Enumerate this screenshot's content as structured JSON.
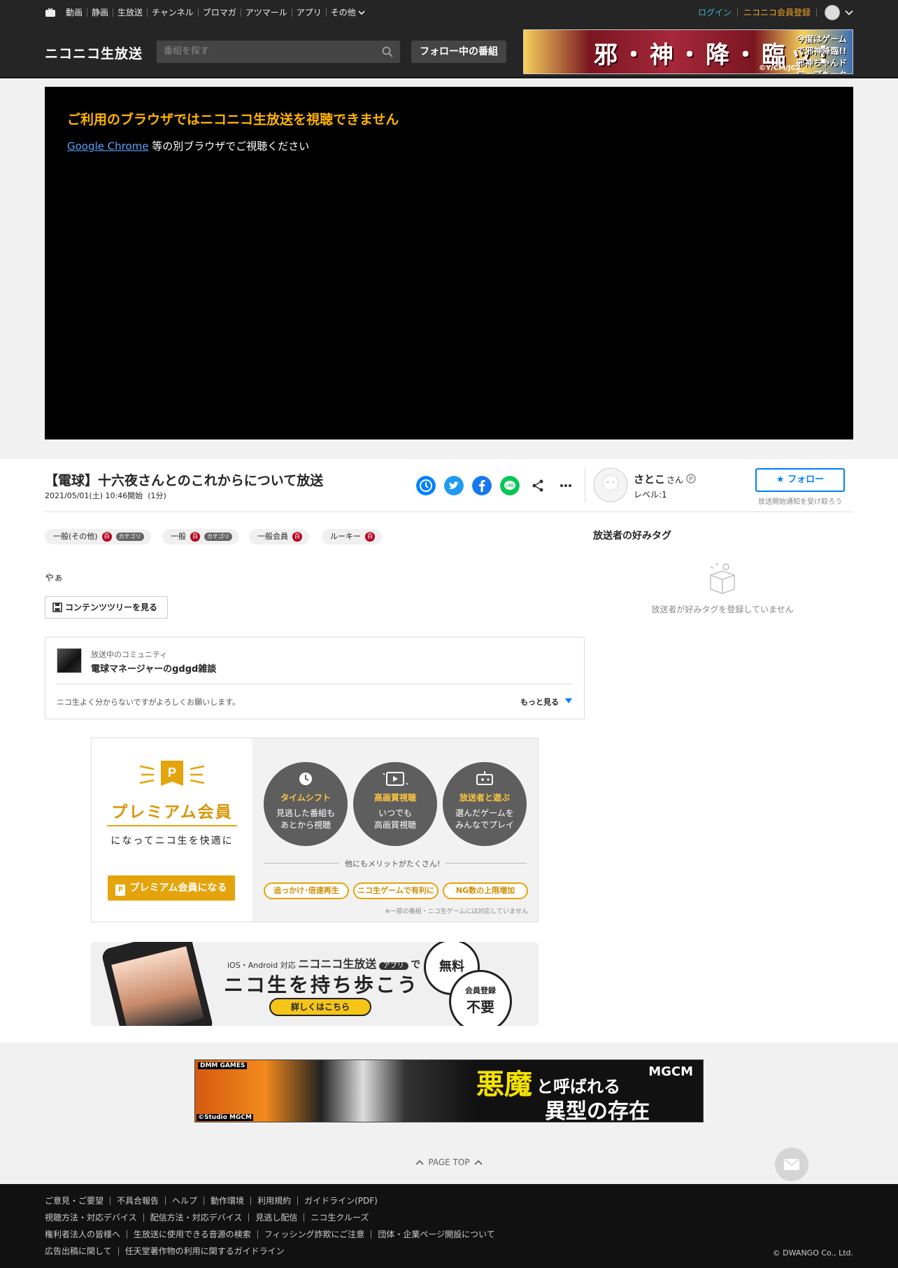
{
  "global_nav": {
    "items": [
      "動画",
      "静画",
      "生放送",
      "チャンネル",
      "ブロマガ",
      "アツマール",
      "アプリ",
      "その他"
    ],
    "login": "ログイン",
    "register": "ニコニコ会員登録"
  },
  "header": {
    "logo": "ニコニコ生放送",
    "search_placeholder": "番組を探す",
    "follow_programs": "フォロー中の番組",
    "banner_title": "邪・神・降・臨ッ!",
    "banner_right": "今度はゲームで邪神降臨!! 邪神ちゃんドロップキック ねじれグッズ",
    "banner_copy": "©Y/CM/JC2"
  },
  "player": {
    "error_title": "ご利用のブラウザではニコニコ生放送を視聴できません",
    "browser_link": "Google Chrome",
    "error_sub": " 等の別ブラウザでご視聴ください"
  },
  "program": {
    "title": "【電球】十六夜さんとのこれからについて放送",
    "start": "2021/05/01(土) 10:46開始",
    "duration": "(1分)",
    "description": "やぁ",
    "contents_tree": "コンテンツツリーを見る"
  },
  "tags": [
    {
      "label": "一般(その他)",
      "lock": "百",
      "category": "カテゴリ"
    },
    {
      "label": "一般",
      "lock": "百",
      "category": "カテゴリ"
    },
    {
      "label": "一般会員",
      "lock": "百"
    },
    {
      "label": "ルーキー",
      "lock": "百"
    }
  ],
  "broadcaster": {
    "name": "さとこ",
    "suffix": "さん",
    "level": "レベル:1",
    "follow": "フォロー",
    "notify": "放送開始通知を受け取ろう"
  },
  "community": {
    "heading": "放送中のコミュニティ",
    "name": "電球マネージャーのgdgd雑談",
    "description": "ニコ生よく分からないですがよろしくお願いします。",
    "more": "もっと見る"
  },
  "fav_tags": {
    "title": "放送者の好みタグ",
    "empty": "放送者が好みタグを登録していません"
  },
  "premium": {
    "title": "プレミアム会員",
    "subtitle": "になってニコ生を快適に",
    "button": "プレミアム会員になる",
    "features": [
      {
        "title": "タイムシフト",
        "desc1": "見逃した番組も",
        "desc2": "あとから視聴"
      },
      {
        "title": "高画質視聴",
        "desc1": "いつでも",
        "desc2": "高画質視聴"
      },
      {
        "title": "放送者と遊ぶ",
        "desc1": "選んだゲームを",
        "desc2": "みんなでプレイ"
      }
    ],
    "more_merits": "他にもメリットがたくさん!",
    "pills": [
      "追っかけ･倍速再生",
      "ニコ生ゲームで有利に",
      "NG数の上限増加"
    ],
    "note": "※一部の番組・ニコ生ゲームには対応していません"
  },
  "app_banner": {
    "platforms": "iOS・Android 対応",
    "app_name": "ニコニコ生放送",
    "app_badge": "アプリ",
    "de": "で",
    "headline": "ニコ生を持ち歩こう",
    "cta": "詳しくはこちら",
    "free": "無料",
    "reg1": "会員登録",
    "reg2": "不要"
  },
  "ad_banner": {
    "brand": "DMM GAMES",
    "text1": "悪魔",
    "text2": "と呼ばれる",
    "text3": "異型の存在",
    "logo": "MGCM",
    "copy": "©Studio MGCM"
  },
  "page_top": "PAGE TOP",
  "footer": {
    "row1": [
      "ご意見・ご要望",
      "不具合報告",
      "ヘルプ",
      "動作環境",
      "利用規約",
      "ガイドライン(PDF)"
    ],
    "row2": [
      "視聴方法・対応デバイス",
      "配信方法・対応デバイス",
      "見逃し配信",
      "ニコ生クルーズ"
    ],
    "row3": [
      "権利者法人の皆様へ",
      "生放送に使用できる音源の検索",
      "フィッシング詐欺にご注意",
      "団体・企業ページ開設について"
    ],
    "row4": [
      "広告出稿に関して",
      "任天堂著作物の利用に関するガイドライン"
    ],
    "copyright": "© DWANGO Co., Ltd."
  },
  "colors": {
    "accent": "#ffb400",
    "follow_blue": "#0080ff",
    "login_link": "#3fb3cf",
    "register_link": "#f5a623",
    "premium_gold": "#e6a40c"
  }
}
